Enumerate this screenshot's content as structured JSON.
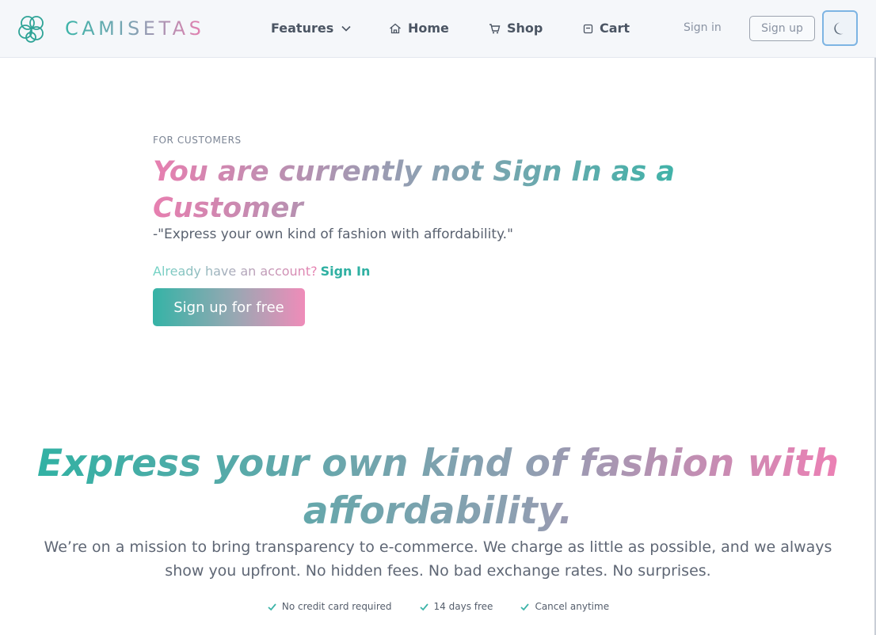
{
  "nav": {
    "brand": "CAMISETAS",
    "features_label": "Features",
    "home_label": "Home",
    "shop_label": "Shop",
    "cart_label": "Cart",
    "signin_label": "Sign in",
    "signup_label": "Sign up"
  },
  "hero": {
    "eyebrow": "FOR CUSTOMERS",
    "title": "You are currently not Sign In as a Customer",
    "quote": "-\"Express your own kind of fashion with affordability.\"",
    "already_text": "Already have an account?",
    "signin_link": "Sign In",
    "cta_label": "Sign up for free"
  },
  "mission": {
    "title": "Express your own kind of fashion with affordability.",
    "text": "We’re on a mission to bring transparency to e-commerce. We charge as little as possible, and we always show you upfront. No hidden fees. No bad exchange rates. No surprises.",
    "perks": [
      "No credit card required",
      "14 days free",
      "Cancel anytime"
    ]
  },
  "colors": {
    "teal": "#3cb4a8",
    "pink": "#e77fb0",
    "slate": "#8ea0b2"
  }
}
